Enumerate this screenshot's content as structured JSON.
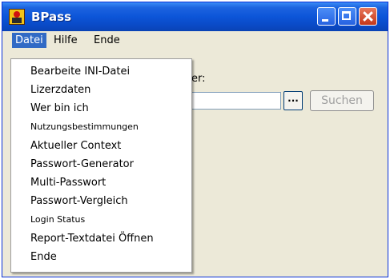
{
  "window": {
    "title": "BPass",
    "accent_color": "#0c55d8",
    "icon": "app-icon"
  },
  "menubar": {
    "items": [
      "Datei",
      "Hilfe",
      "Ende"
    ]
  },
  "main": {
    "label_fragment": "er:",
    "browse_label": "...",
    "search_label": "Suchen"
  },
  "dropdown": {
    "items": [
      "Bearbeite INI-Datei",
      "Lizerzdaten",
      "Wer bin ich",
      "Nutzungsbestimmungen",
      "Aktueller Context",
      "Passwort-Generator",
      "Multi-Passwort",
      "Passwort-Vergleich",
      "Login Status",
      "Report-Textdatei Öffnen",
      "Ende"
    ]
  }
}
